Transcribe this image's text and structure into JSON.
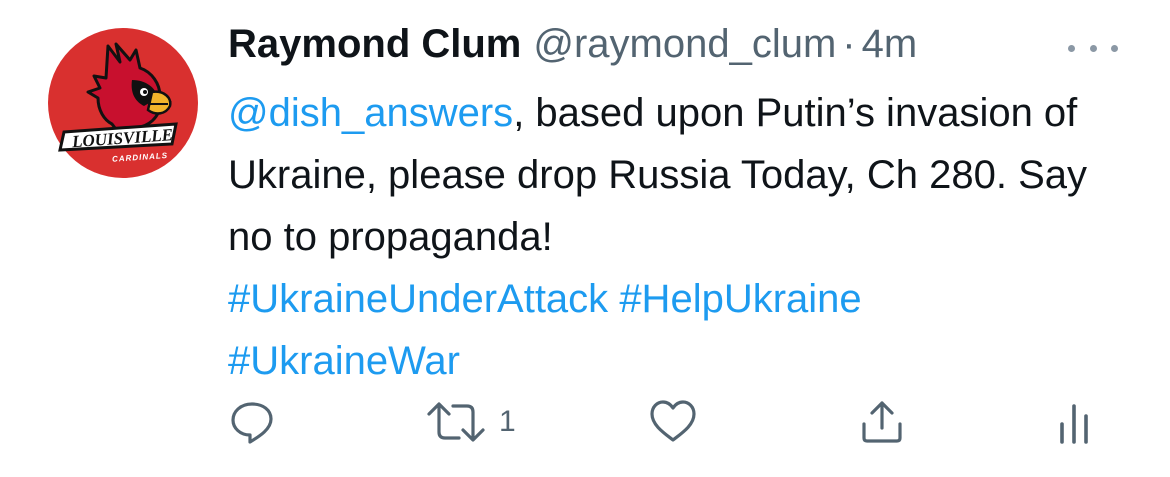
{
  "tweet": {
    "author": {
      "display_name": "Raymond Clum",
      "handle": "@raymond_clum",
      "separator": "·",
      "time": "4m",
      "avatar": {
        "wordmark": "LOUISVILLE",
        "subtext": "CARDINALS",
        "colors": {
          "circle": "#d9302f",
          "bird": "#c8102e",
          "beak": "#f2b52b",
          "outline": "#111111"
        }
      }
    },
    "body": {
      "mention": "@dish_answers",
      "text": ", based upon Putin’s invasion of Ukraine, please drop Russia Today, Ch 280.  Say no to propaganda!",
      "hashtags": [
        "#UkraineUnderAttack",
        "#HelpUkraine",
        "#UkraineWar"
      ]
    },
    "actions": {
      "retweet_count": "1"
    },
    "icons": {
      "more": "more-icon",
      "reply": "reply-icon",
      "retweet": "retweet-icon",
      "like": "heart-icon",
      "share": "share-icon",
      "analytics": "analytics-icon"
    },
    "colors": {
      "link": "#1d9bf0",
      "text": "#0f1419",
      "muted": "#536471"
    }
  }
}
